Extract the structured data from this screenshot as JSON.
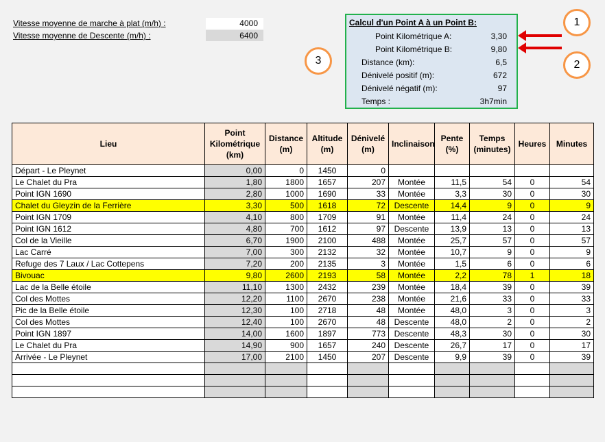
{
  "speeds": {
    "flat_label": "Vitesse moyenne de marche à plat (m/h) :",
    "flat_value": "4000",
    "descent_label": "Vitesse moyenne de Descente (m/h) :",
    "descent_value": "6400"
  },
  "calc": {
    "title": "Calcul d'un Point A à un Point B:",
    "rows": [
      {
        "label": "Point Kilométrique A:",
        "value": "3,30"
      },
      {
        "label": "Point Kilométrique B:",
        "value": "9,80"
      },
      {
        "label": "Distance (km):",
        "value": "6,5"
      },
      {
        "label": "Dénivelé positif (m):",
        "value": "672"
      },
      {
        "label": "Dénivelé négatif (m):",
        "value": "97"
      },
      {
        "label": "Temps :",
        "value": "3h7min"
      }
    ]
  },
  "callouts": [
    "1",
    "2",
    "3"
  ],
  "colors": {
    "highlight": "#ffff00",
    "header": "#fde9d9",
    "calc_bg": "#dce6f1",
    "calc_border": "#22b14c",
    "arrow": "#e00000",
    "circle": "#f79646"
  },
  "table": {
    "headers": [
      "Lieu",
      "Point Kilométrique (km)",
      "Distance (m)",
      "Altitude (m)",
      "Dénivelé (m)",
      "Inclinaison",
      "Pente (%)",
      "Temps (minutes)",
      "Heures",
      "Minutes"
    ],
    "rows": [
      [
        "Départ - Le Pleynet",
        "0,00",
        "0",
        "1450",
        "0",
        "",
        "",
        "",
        "",
        ""
      ],
      [
        "Le Chalet du Pra",
        "1,80",
        "1800",
        "1657",
        "207",
        "Montée",
        "11,5",
        "54",
        "0",
        "54"
      ],
      [
        "Point IGN 1690",
        "2,80",
        "1000",
        "1690",
        "33",
        "Montée",
        "3,3",
        "30",
        "0",
        "30"
      ],
      [
        "Chalet du Gleyzin de la Ferrière",
        "3,30",
        "500",
        "1618",
        "72",
        "Descente",
        "14,4",
        "9",
        "0",
        "9"
      ],
      [
        "Point IGN 1709",
        "4,10",
        "800",
        "1709",
        "91",
        "Montée",
        "11,4",
        "24",
        "0",
        "24"
      ],
      [
        "Point IGN 1612",
        "4,80",
        "700",
        "1612",
        "97",
        "Descente",
        "13,9",
        "13",
        "0",
        "13"
      ],
      [
        "Col de la Vieille",
        "6,70",
        "1900",
        "2100",
        "488",
        "Montée",
        "25,7",
        "57",
        "0",
        "57"
      ],
      [
        "Lac Carré",
        "7,00",
        "300",
        "2132",
        "32",
        "Montée",
        "10,7",
        "9",
        "0",
        "9"
      ],
      [
        "Refuge des 7 Laux / Lac Cottepens",
        "7,20",
        "200",
        "2135",
        "3",
        "Montée",
        "1,5",
        "6",
        "0",
        "6"
      ],
      [
        "Bivouac",
        "9,80",
        "2600",
        "2193",
        "58",
        "Montée",
        "2,2",
        "78",
        "1",
        "18"
      ],
      [
        "Lac de la Belle étoile",
        "11,10",
        "1300",
        "2432",
        "239",
        "Montée",
        "18,4",
        "39",
        "0",
        "39"
      ],
      [
        "Col des Mottes",
        "12,20",
        "1100",
        "2670",
        "238",
        "Montée",
        "21,6",
        "33",
        "0",
        "33"
      ],
      [
        "Pic de la Belle étoile",
        "12,30",
        "100",
        "2718",
        "48",
        "Montée",
        "48,0",
        "3",
        "0",
        "3"
      ],
      [
        "Col des Mottes",
        "12,40",
        "100",
        "2670",
        "48",
        "Descente",
        "48,0",
        "2",
        "0",
        "2"
      ],
      [
        "Point IGN 1897",
        "14,00",
        "1600",
        "1897",
        "773",
        "Descente",
        "48,3",
        "30",
        "0",
        "30"
      ],
      [
        "Le Chalet du Pra",
        "14,90",
        "900",
        "1657",
        "240",
        "Descente",
        "26,7",
        "17",
        "0",
        "17"
      ],
      [
        "Arrivée - Le Pleynet",
        "17,00",
        "2100",
        "1450",
        "207",
        "Descente",
        "9,9",
        "39",
        "0",
        "39"
      ],
      [
        "",
        "",
        "",
        "",
        "",
        "",
        "",
        "",
        "",
        ""
      ],
      [
        "",
        "",
        "",
        "",
        "",
        "",
        "",
        "",
        "",
        ""
      ],
      [
        "",
        "",
        "",
        "",
        "",
        "",
        "",
        "",
        "",
        ""
      ]
    ],
    "highlighted_rows": [
      3,
      9
    ]
  }
}
